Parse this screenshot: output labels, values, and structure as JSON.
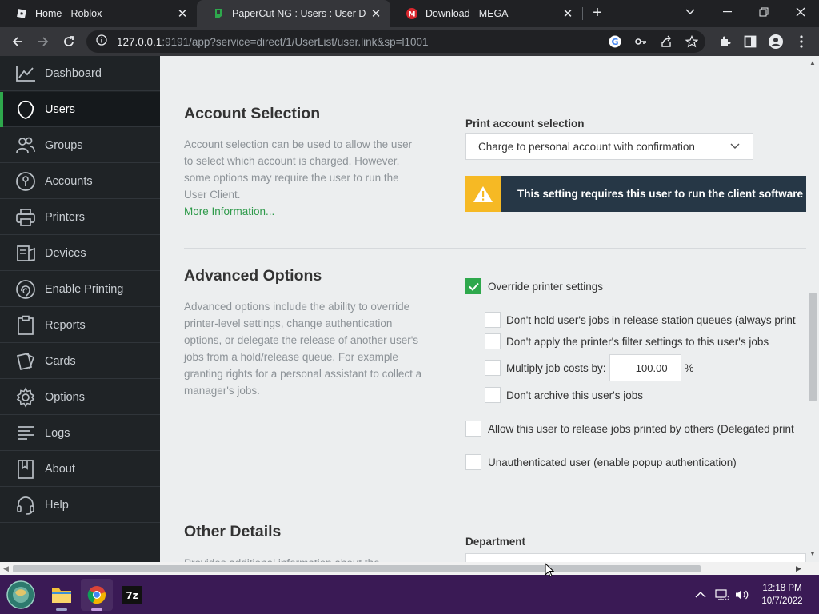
{
  "browser": {
    "tabs": [
      {
        "title": "Home - Roblox",
        "active": false
      },
      {
        "title": "PaperCut NG : Users : User Detail",
        "active": true
      },
      {
        "title": "Download - MEGA",
        "active": false
      }
    ],
    "url_host": "127.0.0.1",
    "url_rest": ":9191/app?service=direct/1/UserList/user.link&sp=l1001"
  },
  "sidebar": {
    "items": [
      {
        "label": "Dashboard",
        "icon": "chart-line-icon",
        "active": false
      },
      {
        "label": "Users",
        "icon": "user-icon",
        "active": true
      },
      {
        "label": "Groups",
        "icon": "group-icon",
        "active": false
      },
      {
        "label": "Accounts",
        "icon": "accounts-icon",
        "active": false
      },
      {
        "label": "Printers",
        "icon": "printer-icon",
        "active": false
      },
      {
        "label": "Devices",
        "icon": "device-icon",
        "active": false
      },
      {
        "label": "Enable Printing",
        "icon": "fingerprint-icon",
        "active": false
      },
      {
        "label": "Reports",
        "icon": "clipboard-icon",
        "active": false
      },
      {
        "label": "Cards",
        "icon": "cards-icon",
        "active": false
      },
      {
        "label": "Options",
        "icon": "gear-icon",
        "active": false
      },
      {
        "label": "Logs",
        "icon": "list-icon",
        "active": false
      },
      {
        "label": "About",
        "icon": "book-icon",
        "active": false
      },
      {
        "label": "Help",
        "icon": "headset-icon",
        "active": false
      }
    ]
  },
  "account_selection": {
    "title": "Account Selection",
    "description": "Account selection can be used to allow the user to select which account is charged. However, some options may require the user to run the User Client.",
    "more_info": "More Information...",
    "field_label": "Print account selection",
    "selected_option": "Charge to personal account with confirmation",
    "warning": "This setting requires this user to run the client software at"
  },
  "advanced_options": {
    "title": "Advanced Options",
    "description": "Advanced options include the ability to override printer-level settings, change authentication options, or delegate the release of another user's jobs from a hold/release queue. For example granting rights for a personal assistant to collect a manager's jobs.",
    "override": {
      "label": "Override printer settings",
      "checked": true
    },
    "sub_options": [
      {
        "label": "Don't hold user's jobs in release station queues (always print",
        "checked": false
      },
      {
        "label": "Don't apply the printer's filter settings to this user's jobs",
        "checked": false
      },
      {
        "label": "Multiply job costs by:",
        "checked": false
      },
      {
        "label": "Don't archive this user's jobs",
        "checked": false
      }
    ],
    "multiplier_value": "100.00",
    "multiplier_unit": "%",
    "delegated": {
      "label": "Allow this user to release jobs printed by others (Delegated print",
      "checked": false
    },
    "unauthenticated": {
      "label": "Unauthenticated user (enable popup authentication)",
      "checked": false
    }
  },
  "other_details": {
    "title": "Other Details",
    "description_partial": "Provides additional information about the",
    "department_label": "Department"
  },
  "taskbar": {
    "time": "12:18 PM",
    "date": "10/7/2022"
  },
  "colors": {
    "accent": "#2ea84c",
    "sidebar_bg": "#1f2326",
    "warning_icon": "#f6b924",
    "warning_bg": "#263746"
  }
}
